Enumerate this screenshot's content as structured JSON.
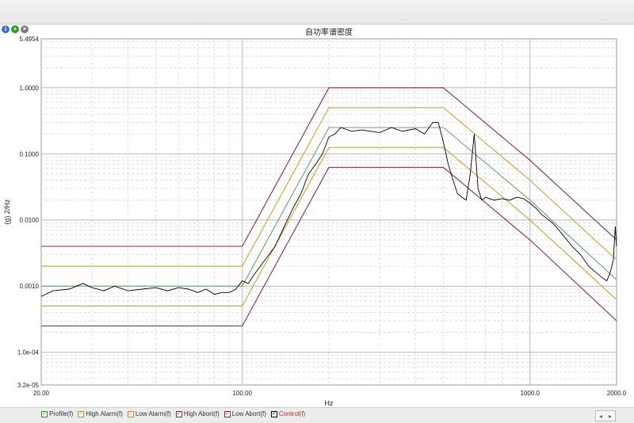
{
  "window": {
    "title": "自功率谱密度"
  },
  "toolbar_icons": [
    {
      "icon": "info-icon"
    },
    {
      "icon": "add-icon"
    },
    {
      "icon": "close-icon"
    }
  ],
  "legend": [
    {
      "label": "Profile(f)",
      "color": "#2e8b2e"
    },
    {
      "label": "High Alarm(f)",
      "color": "#d08a1a"
    },
    {
      "label": "Low Alarm(f)",
      "color": "#d08a1a"
    },
    {
      "label": "High Abort(f)",
      "color": "#8b2a4a"
    },
    {
      "label": "Low Abort(f)",
      "color": "#8b2a4a"
    },
    {
      "label": "Control(f)",
      "color": "#000000"
    }
  ],
  "scroll": {
    "left": "◂",
    "right": "▸"
  },
  "chart_data": {
    "type": "line",
    "title": "自功率谱密度",
    "xlabel": "Hz",
    "ylabel": "(g) 2/Hz",
    "xscale": "log",
    "yscale": "log",
    "xlim": [
      20,
      2000
    ],
    "ylim": [
      3.2e-05,
      5.4954
    ],
    "xtick_labels": [
      "20.00",
      "100.00",
      "1000.0",
      "2000.0"
    ],
    "xtick_values": [
      20,
      100,
      1000,
      2000
    ],
    "ytick_labels": [
      "5.4954",
      "1.0000",
      "0.1000",
      "0.0100",
      "0.0010",
      "1.0e-04",
      "3.2e-05"
    ],
    "ytick_values": [
      5.4954,
      1.0,
      0.1,
      0.01,
      0.001,
      0.0001,
      3.2e-05
    ],
    "grid": true,
    "series": [
      {
        "name": "High Abort(f)",
        "color": "#8b2a4a",
        "x": [
          20,
          100,
          200,
          500,
          1000,
          2000
        ],
        "y": [
          0.004,
          0.004,
          1.0,
          1.0,
          0.08,
          0.005
        ]
      },
      {
        "name": "High Alarm(f)",
        "color": "#c8a23a",
        "x": [
          20,
          100,
          200,
          500,
          1000,
          2000
        ],
        "y": [
          0.002,
          0.002,
          0.5,
          0.5,
          0.04,
          0.0025
        ]
      },
      {
        "name": "Profile(f)",
        "color": "#6aa36a",
        "x": [
          20,
          100,
          200,
          500,
          1000,
          2000
        ],
        "y": [
          0.001,
          0.001,
          0.25,
          0.25,
          0.02,
          0.00125
        ]
      },
      {
        "name": "Low Alarm(f)",
        "color": "#c8a23a",
        "x": [
          20,
          100,
          200,
          500,
          1000,
          2000
        ],
        "y": [
          0.0005,
          0.0005,
          0.125,
          0.125,
          0.01,
          0.000625
        ]
      },
      {
        "name": "Low Abort(f)",
        "color": "#8b2a4a",
        "x": [
          20,
          100,
          200,
          500,
          1000,
          2000
        ],
        "y": [
          0.00025,
          0.00025,
          0.0625,
          0.0625,
          0.005,
          0.0003
        ]
      },
      {
        "name": "Control(f)",
        "color": "#000000",
        "x": [
          20,
          22,
          25,
          28,
          30,
          33,
          36,
          40,
          45,
          50,
          55,
          60,
          65,
          70,
          75,
          80,
          85,
          90,
          95,
          100,
          105,
          110,
          120,
          130,
          140,
          150,
          160,
          170,
          180,
          190,
          200,
          210,
          220,
          240,
          260,
          280,
          300,
          330,
          360,
          400,
          430,
          460,
          480,
          500,
          520,
          540,
          560,
          580,
          600,
          620,
          640,
          660,
          680,
          700,
          750,
          800,
          850,
          900,
          950,
          1000,
          1050,
          1100,
          1200,
          1300,
          1400,
          1500,
          1600,
          1700,
          1800,
          1850,
          1900,
          1950,
          1980,
          2000
        ],
        "y": [
          0.0007,
          0.00085,
          0.0009,
          0.0011,
          0.00095,
          0.00085,
          0.001,
          0.00085,
          0.0009,
          0.00095,
          0.00085,
          0.00095,
          0.0009,
          0.0008,
          0.0009,
          0.00075,
          0.0008,
          0.0008,
          0.0009,
          0.0012,
          0.0011,
          0.0015,
          0.0025,
          0.004,
          0.008,
          0.015,
          0.025,
          0.05,
          0.07,
          0.1,
          0.18,
          0.2,
          0.25,
          0.22,
          0.23,
          0.22,
          0.21,
          0.25,
          0.22,
          0.24,
          0.2,
          0.3,
          0.3,
          0.15,
          0.07,
          0.04,
          0.025,
          0.022,
          0.02,
          0.05,
          0.2,
          0.03,
          0.02,
          0.022,
          0.02,
          0.021,
          0.02,
          0.022,
          0.021,
          0.018,
          0.015,
          0.012,
          0.009,
          0.006,
          0.004,
          0.003,
          0.002,
          0.0016,
          0.0013,
          0.0012,
          0.0016,
          0.0025,
          0.008,
          0.004
        ]
      }
    ]
  }
}
